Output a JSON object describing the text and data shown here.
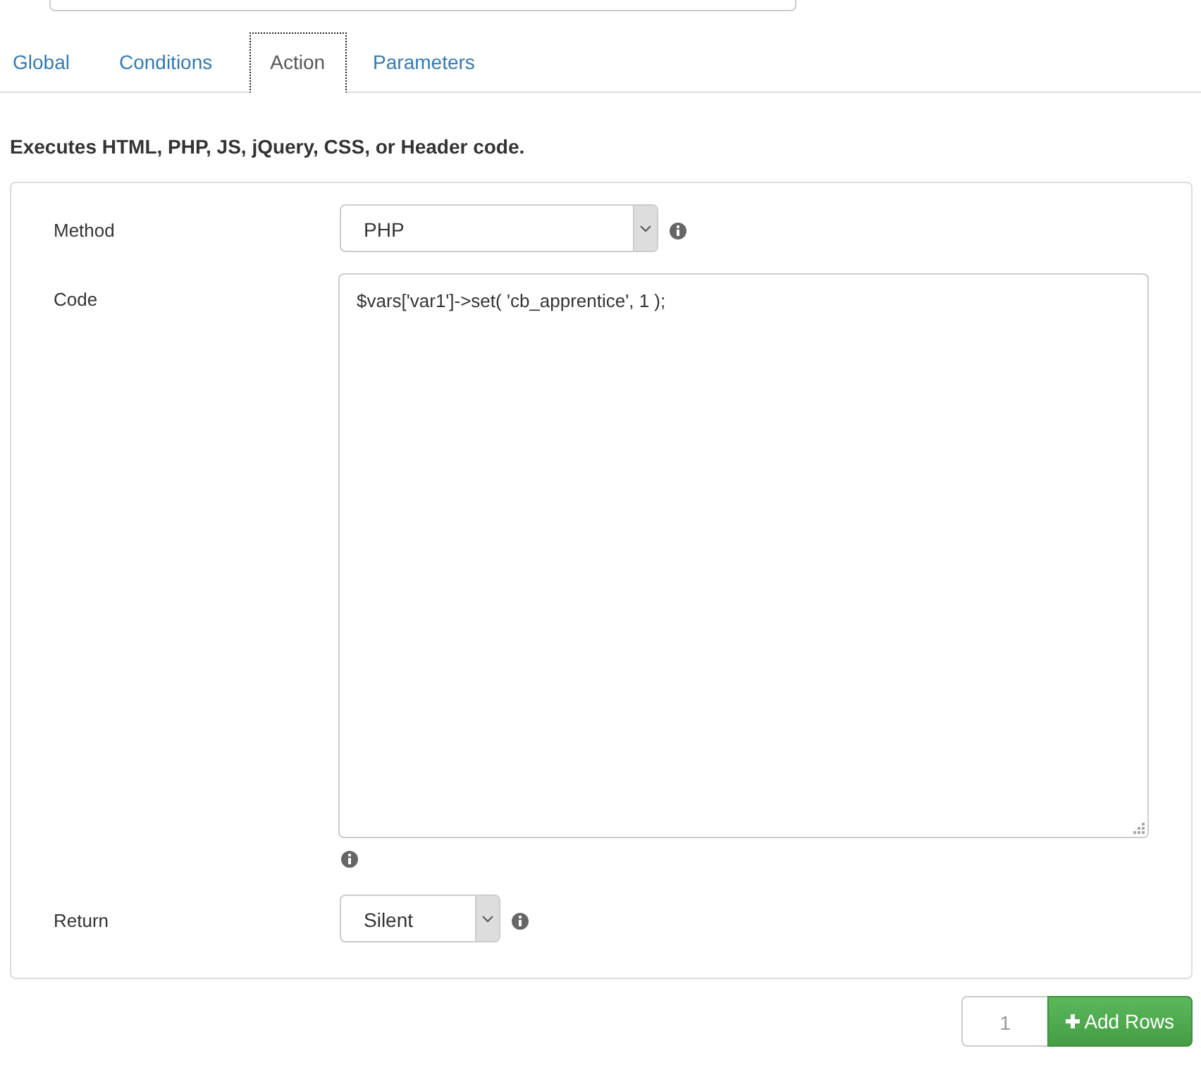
{
  "top_field": {
    "kind": "input"
  },
  "tabs": [
    {
      "label": "Global",
      "selected": false
    },
    {
      "label": "Conditions",
      "selected": false
    },
    {
      "label": "Action",
      "selected": true
    },
    {
      "label": "Parameters",
      "selected": false
    }
  ],
  "description": "Executes HTML, PHP, JS, jQuery, CSS, or Header code.",
  "fields": [
    {
      "label": "Method",
      "kind": "select",
      "value": "PHP",
      "wide": true,
      "help_below": false
    },
    {
      "label": "Code",
      "kind": "textarea",
      "value": "$vars['var1']->set( 'cb_apprentice', 1 );",
      "help_below": true
    },
    {
      "label": "Return",
      "kind": "select",
      "value": "Silent",
      "wide": false,
      "help_below": false
    }
  ],
  "footer": {
    "rows_value": "1",
    "button": "Add Rows"
  }
}
